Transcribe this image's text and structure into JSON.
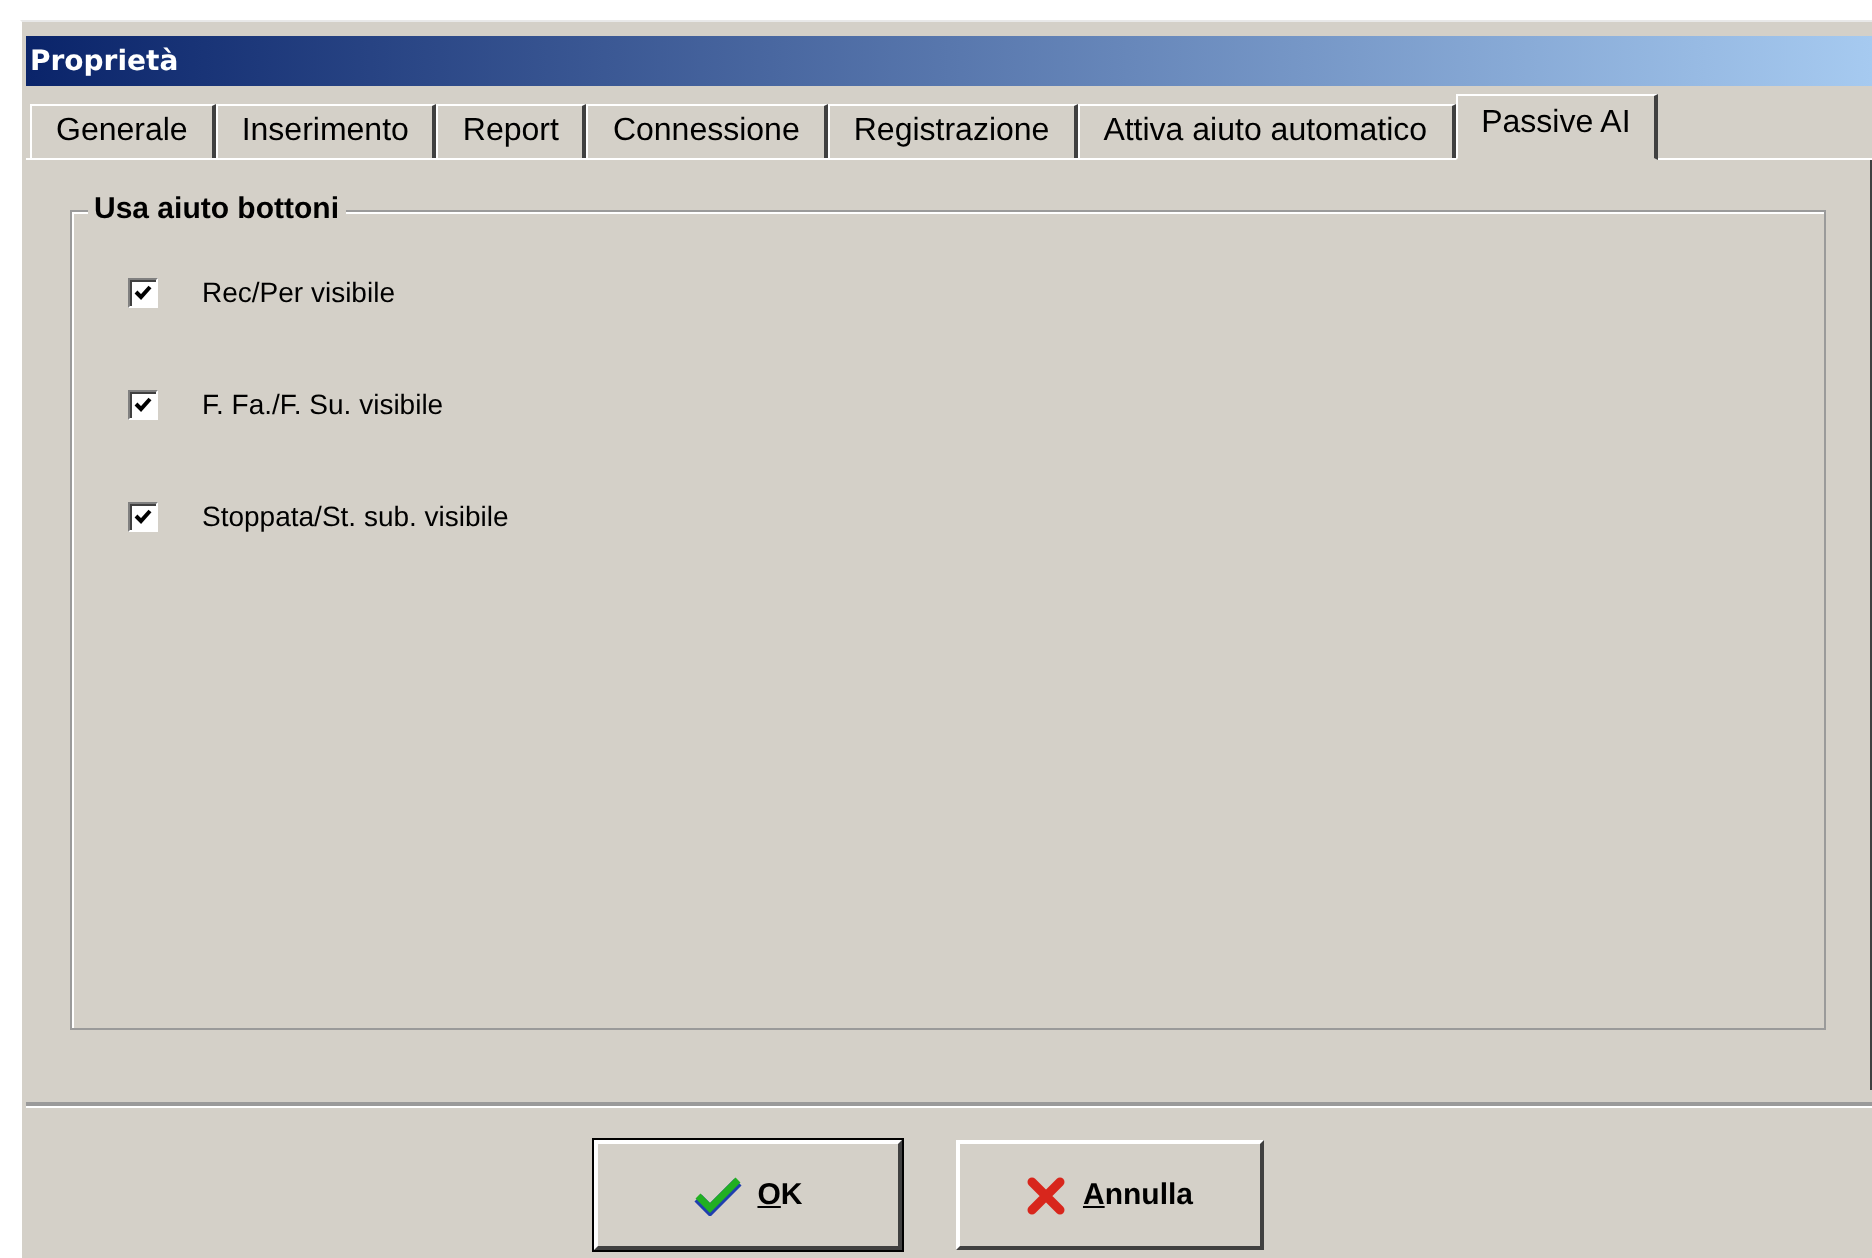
{
  "window": {
    "title": "Proprietà"
  },
  "tabs": [
    {
      "label": "Generale",
      "selected": false
    },
    {
      "label": "Inserimento",
      "selected": false
    },
    {
      "label": "Report",
      "selected": false
    },
    {
      "label": "Connessione",
      "selected": false
    },
    {
      "label": "Registrazione",
      "selected": false
    },
    {
      "label": "Attiva aiuto automatico",
      "selected": false
    },
    {
      "label": "Passive AI",
      "selected": true
    }
  ],
  "group": {
    "title": "Usa aiuto bottoni",
    "options": [
      {
        "label": "Rec/Per visibile",
        "checked": true
      },
      {
        "label": "F. Fa./F. Su. visibile",
        "checked": true
      },
      {
        "label": "Stoppata/St. sub. visibile",
        "checked": true
      }
    ]
  },
  "buttons": [
    {
      "label": "OK",
      "kind": "ok",
      "default": true
    },
    {
      "label": "Annulla",
      "kind": "cancel",
      "default": false
    }
  ]
}
